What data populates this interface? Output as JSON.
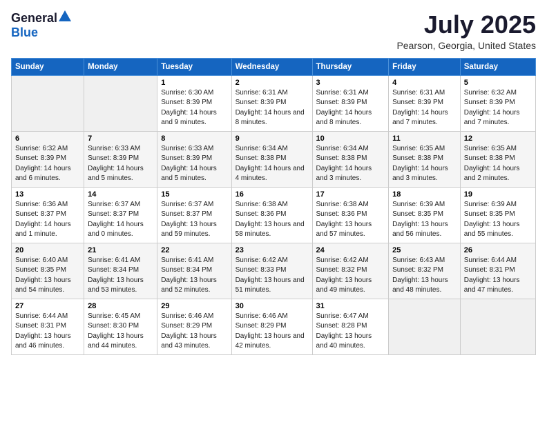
{
  "header": {
    "logo_general": "General",
    "logo_blue": "Blue",
    "month_title": "July 2025",
    "location": "Pearson, Georgia, United States"
  },
  "weekdays": [
    "Sunday",
    "Monday",
    "Tuesday",
    "Wednesday",
    "Thursday",
    "Friday",
    "Saturday"
  ],
  "weeks": [
    [
      {
        "day": "",
        "info": ""
      },
      {
        "day": "",
        "info": ""
      },
      {
        "day": "1",
        "info": "Sunrise: 6:30 AM\nSunset: 8:39 PM\nDaylight: 14 hours and 9 minutes."
      },
      {
        "day": "2",
        "info": "Sunrise: 6:31 AM\nSunset: 8:39 PM\nDaylight: 14 hours and 8 minutes."
      },
      {
        "day": "3",
        "info": "Sunrise: 6:31 AM\nSunset: 8:39 PM\nDaylight: 14 hours and 8 minutes."
      },
      {
        "day": "4",
        "info": "Sunrise: 6:31 AM\nSunset: 8:39 PM\nDaylight: 14 hours and 7 minutes."
      },
      {
        "day": "5",
        "info": "Sunrise: 6:32 AM\nSunset: 8:39 PM\nDaylight: 14 hours and 7 minutes."
      }
    ],
    [
      {
        "day": "6",
        "info": "Sunrise: 6:32 AM\nSunset: 8:39 PM\nDaylight: 14 hours and 6 minutes."
      },
      {
        "day": "7",
        "info": "Sunrise: 6:33 AM\nSunset: 8:39 PM\nDaylight: 14 hours and 5 minutes."
      },
      {
        "day": "8",
        "info": "Sunrise: 6:33 AM\nSunset: 8:39 PM\nDaylight: 14 hours and 5 minutes."
      },
      {
        "day": "9",
        "info": "Sunrise: 6:34 AM\nSunset: 8:38 PM\nDaylight: 14 hours and 4 minutes."
      },
      {
        "day": "10",
        "info": "Sunrise: 6:34 AM\nSunset: 8:38 PM\nDaylight: 14 hours and 3 minutes."
      },
      {
        "day": "11",
        "info": "Sunrise: 6:35 AM\nSunset: 8:38 PM\nDaylight: 14 hours and 3 minutes."
      },
      {
        "day": "12",
        "info": "Sunrise: 6:35 AM\nSunset: 8:38 PM\nDaylight: 14 hours and 2 minutes."
      }
    ],
    [
      {
        "day": "13",
        "info": "Sunrise: 6:36 AM\nSunset: 8:37 PM\nDaylight: 14 hours and 1 minute."
      },
      {
        "day": "14",
        "info": "Sunrise: 6:37 AM\nSunset: 8:37 PM\nDaylight: 14 hours and 0 minutes."
      },
      {
        "day": "15",
        "info": "Sunrise: 6:37 AM\nSunset: 8:37 PM\nDaylight: 13 hours and 59 minutes."
      },
      {
        "day": "16",
        "info": "Sunrise: 6:38 AM\nSunset: 8:36 PM\nDaylight: 13 hours and 58 minutes."
      },
      {
        "day": "17",
        "info": "Sunrise: 6:38 AM\nSunset: 8:36 PM\nDaylight: 13 hours and 57 minutes."
      },
      {
        "day": "18",
        "info": "Sunrise: 6:39 AM\nSunset: 8:35 PM\nDaylight: 13 hours and 56 minutes."
      },
      {
        "day": "19",
        "info": "Sunrise: 6:39 AM\nSunset: 8:35 PM\nDaylight: 13 hours and 55 minutes."
      }
    ],
    [
      {
        "day": "20",
        "info": "Sunrise: 6:40 AM\nSunset: 8:35 PM\nDaylight: 13 hours and 54 minutes."
      },
      {
        "day": "21",
        "info": "Sunrise: 6:41 AM\nSunset: 8:34 PM\nDaylight: 13 hours and 53 minutes."
      },
      {
        "day": "22",
        "info": "Sunrise: 6:41 AM\nSunset: 8:34 PM\nDaylight: 13 hours and 52 minutes."
      },
      {
        "day": "23",
        "info": "Sunrise: 6:42 AM\nSunset: 8:33 PM\nDaylight: 13 hours and 51 minutes."
      },
      {
        "day": "24",
        "info": "Sunrise: 6:42 AM\nSunset: 8:32 PM\nDaylight: 13 hours and 49 minutes."
      },
      {
        "day": "25",
        "info": "Sunrise: 6:43 AM\nSunset: 8:32 PM\nDaylight: 13 hours and 48 minutes."
      },
      {
        "day": "26",
        "info": "Sunrise: 6:44 AM\nSunset: 8:31 PM\nDaylight: 13 hours and 47 minutes."
      }
    ],
    [
      {
        "day": "27",
        "info": "Sunrise: 6:44 AM\nSunset: 8:31 PM\nDaylight: 13 hours and 46 minutes."
      },
      {
        "day": "28",
        "info": "Sunrise: 6:45 AM\nSunset: 8:30 PM\nDaylight: 13 hours and 44 minutes."
      },
      {
        "day": "29",
        "info": "Sunrise: 6:46 AM\nSunset: 8:29 PM\nDaylight: 13 hours and 43 minutes."
      },
      {
        "day": "30",
        "info": "Sunrise: 6:46 AM\nSunset: 8:29 PM\nDaylight: 13 hours and 42 minutes."
      },
      {
        "day": "31",
        "info": "Sunrise: 6:47 AM\nSunset: 8:28 PM\nDaylight: 13 hours and 40 minutes."
      },
      {
        "day": "",
        "info": ""
      },
      {
        "day": "",
        "info": ""
      }
    ]
  ]
}
